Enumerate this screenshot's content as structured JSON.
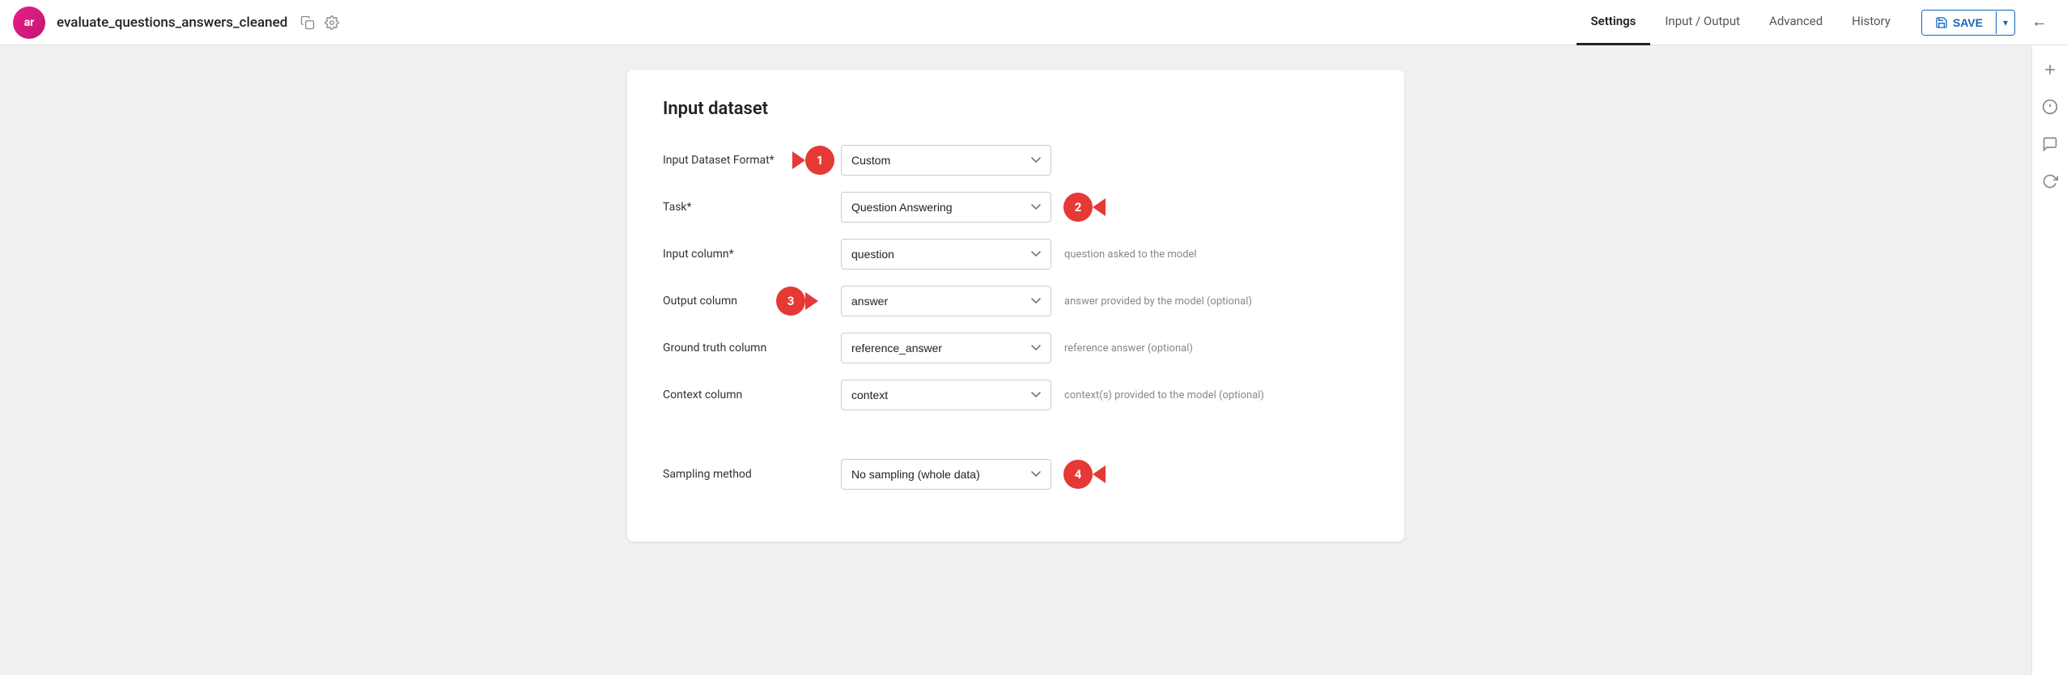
{
  "app": {
    "logo_text": "ar",
    "doc_title": "evaluate_questions_answers_cleaned",
    "copy_icon": "copy",
    "settings_icon": "settings-gear"
  },
  "topbar": {
    "nav_tabs": [
      {
        "id": "settings",
        "label": "Settings",
        "active": true
      },
      {
        "id": "input-output",
        "label": "Input / Output",
        "active": false
      },
      {
        "id": "advanced",
        "label": "Advanced",
        "active": false
      },
      {
        "id": "history",
        "label": "History",
        "active": false
      }
    ],
    "save_label": "SAVE",
    "back_icon": "arrow-left"
  },
  "sidebar": {
    "icons": [
      "plus",
      "info",
      "chat",
      "sync"
    ]
  },
  "form": {
    "section_title": "Input dataset",
    "rows": [
      {
        "id": "input-dataset-format",
        "label": "Input Dataset Format*",
        "select_value": "Custom",
        "select_options": [
          "Custom"
        ],
        "hint": "",
        "badge": "1",
        "badge_pos": "right-of-label"
      },
      {
        "id": "task",
        "label": "Task*",
        "select_value": "Question Answering",
        "select_options": [
          "Question Answering"
        ],
        "hint": "",
        "badge": "2",
        "badge_pos": "right-of-select"
      },
      {
        "id": "input-column",
        "label": "Input column*",
        "select_value": "question",
        "select_options": [
          "question"
        ],
        "hint": "question asked to the model",
        "badge": null
      },
      {
        "id": "output-column",
        "label": "Output column",
        "select_value": "answer",
        "select_options": [
          "answer"
        ],
        "hint": "answer provided by the model (optional)",
        "badge": "3",
        "badge_pos": "left-of-select"
      },
      {
        "id": "ground-truth-column",
        "label": "Ground truth column",
        "select_value": "reference_answer",
        "select_options": [
          "reference_answer"
        ],
        "hint": "reference answer (optional)",
        "badge": null
      },
      {
        "id": "context-column",
        "label": "Context column",
        "select_value": "context",
        "select_options": [
          "context"
        ],
        "hint": "context(s) provided to the model (optional)",
        "badge": null
      }
    ],
    "sampling_row": {
      "id": "sampling-method",
      "label": "Sampling method",
      "select_value": "No sampling (whole data)",
      "select_options": [
        "No sampling (whole data)"
      ],
      "hint": "",
      "badge": "4",
      "badge_pos": "right-of-select"
    }
  }
}
